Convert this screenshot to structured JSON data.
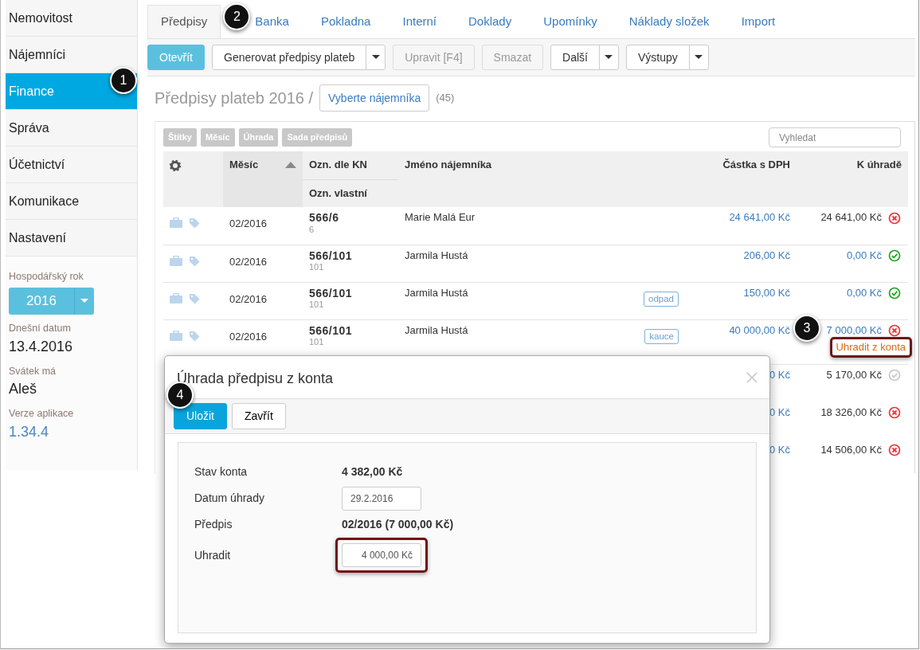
{
  "sidebar": {
    "items": [
      {
        "label": "Nemovitost",
        "selected": false
      },
      {
        "label": "Nájemníci",
        "selected": false
      },
      {
        "label": "Finance",
        "selected": true,
        "callout": "1"
      },
      {
        "label": "Správa",
        "selected": false
      },
      {
        "label": "Účetnictví",
        "selected": false
      },
      {
        "label": "Komunikace",
        "selected": false
      },
      {
        "label": "Nastavení",
        "selected": false
      }
    ],
    "fiscal_year": {
      "label": "Hospodářský rok",
      "value": "2016"
    },
    "info": [
      {
        "label": "Dnešní datum",
        "value": "13.4.2016",
        "kind": "plain"
      },
      {
        "label": "Svátek má",
        "value": "Aleš",
        "kind": "plain"
      },
      {
        "label": "Verze aplikace",
        "value": "1.34.4",
        "kind": "link"
      }
    ]
  },
  "tabs": [
    {
      "label": "Předpisy",
      "selected": true
    },
    {
      "label": "Banka",
      "selected": false,
      "callout": "2"
    },
    {
      "label": "Pokladna",
      "selected": false
    },
    {
      "label": "Interní",
      "selected": false
    },
    {
      "label": "Doklady",
      "selected": false
    },
    {
      "label": "Upomínky",
      "selected": false
    },
    {
      "label": "Náklady složek",
      "selected": false
    },
    {
      "label": "Import",
      "selected": false
    }
  ],
  "toolbar": [
    {
      "label": "Otevřít",
      "kind": "info",
      "disabled": false,
      "dropdown": false
    },
    {
      "label": "Generovat předpisy plateb",
      "kind": "default",
      "disabled": false,
      "dropdown": true
    },
    {
      "label": "Upravit [F4]",
      "kind": "default",
      "disabled": true,
      "dropdown": false
    },
    {
      "label": "Smazat",
      "kind": "default",
      "disabled": true,
      "dropdown": false
    },
    {
      "label": "Další",
      "kind": "default",
      "disabled": false,
      "dropdown": true
    },
    {
      "label": "Výstupy",
      "kind": "default",
      "disabled": false,
      "dropdown": true
    }
  ],
  "heading": {
    "title": "Předpisy plateb 2016 /",
    "tenant_button": "Vyberte nájemníka",
    "count": "(45)"
  },
  "filters": [
    "Štítky",
    "Měsíc",
    "Úhrada",
    "Sada předpisů"
  ],
  "search": {
    "placeholder": "Vyhledat"
  },
  "table": {
    "columns": [
      {
        "label": "Měsíc",
        "sorted": true
      },
      {
        "label": "Ozn. dle KN",
        "sub": "Ozn. vlastní",
        "sorted": false
      },
      {
        "label": "Jméno nájemníka",
        "sorted": false
      },
      {
        "label": "Částka s DPH",
        "sorted": false
      },
      {
        "label": "K úhradě",
        "sorted": false
      }
    ],
    "rows": [
      {
        "covered": false,
        "month": "02/2016",
        "code": "566/6",
        "own_code": "6",
        "tenant": "Marie Malá Eur",
        "amount": "24 641,00 Kč",
        "due": "24 641,00 Kč",
        "due_link": false,
        "kind": "unpaid"
      },
      {
        "covered": false,
        "month": "02/2016",
        "code": "566/101",
        "own_code": "101",
        "tenant": "Jarmila Hustá",
        "amount": "206,00 Kč",
        "due": "0,00 Kč",
        "due_link": true,
        "kind": "paid"
      },
      {
        "covered": false,
        "month": "02/2016",
        "code": "566/101",
        "own_code": "101",
        "tenant": "Jarmila Hustá",
        "tag": "odpad",
        "amount": "150,00 Kč",
        "due": "0,00 Kč",
        "due_link": true,
        "kind": "paid"
      },
      {
        "covered": false,
        "month": "02/2016",
        "code": "566/101",
        "own_code": "101",
        "tenant": "Jarmila Hustá",
        "tag": "kauce",
        "amount": "40 000,00 Kč",
        "due": "7 000,00 Kč",
        "due_link": true,
        "kind": "unpaid",
        "action": {
          "label": "Uhradit z konta",
          "highlighted": true,
          "callout": "3"
        }
      },
      {
        "covered": true,
        "amount": "0 Kč",
        "due": "5 170,00 Kč",
        "due_link": false,
        "kind": "pending"
      },
      {
        "covered": true,
        "amount": "0 Kč",
        "due": "18 326,00 Kč",
        "due_link": false,
        "kind": "unpaid"
      },
      {
        "covered": true,
        "amount": "0 Kč",
        "due": "14 506,00 Kč",
        "due_link": false,
        "kind": "unpaid"
      }
    ]
  },
  "modal": {
    "title": "Úhrada předpisu z konta",
    "buttons": [
      {
        "label": "Uložit",
        "kind": "primary",
        "callout": "4"
      },
      {
        "label": "Zavřít",
        "kind": "default"
      }
    ],
    "fields": [
      {
        "label": "Stav konta",
        "value": "4 382,00 Kč",
        "kind": "text"
      },
      {
        "label": "Datum úhrady",
        "value": "29.2.2016",
        "kind": "input",
        "highlighted": false
      },
      {
        "label": "Předpis",
        "value": "02/2016 (7 000,00 Kč)",
        "kind": "text"
      },
      {
        "label": "Uhradit",
        "value": "4 000,00 Kč",
        "kind": "input",
        "highlighted": true
      }
    ]
  }
}
